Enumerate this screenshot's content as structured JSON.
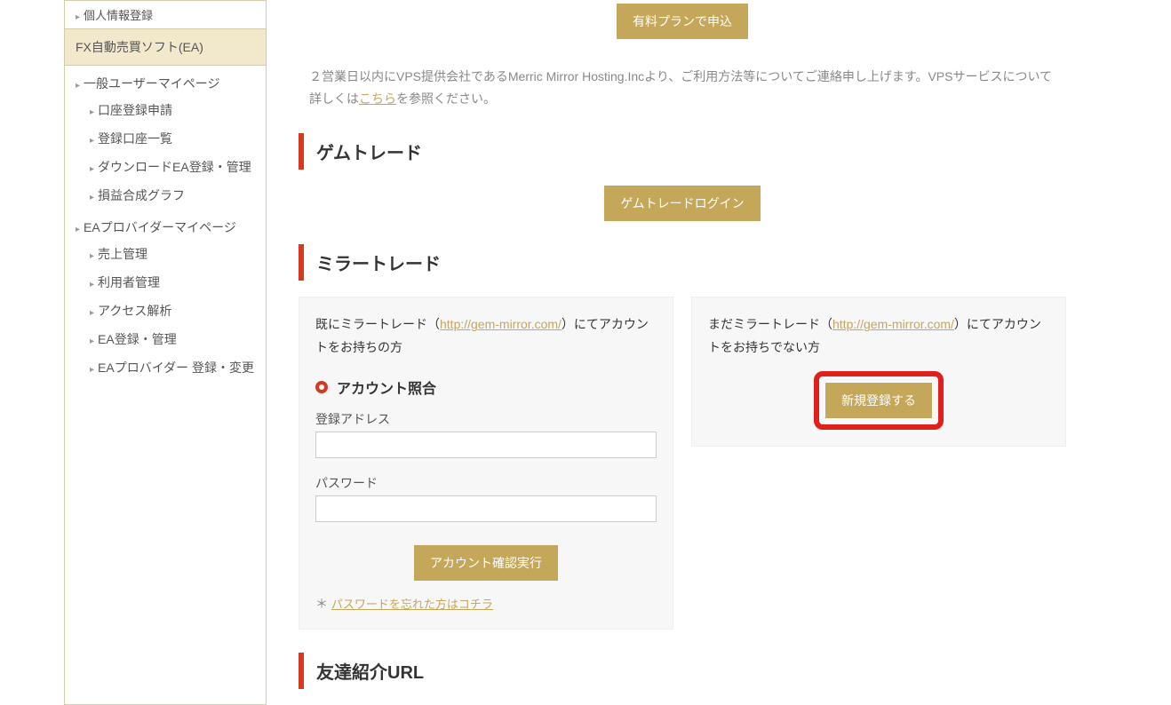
{
  "sidebar": {
    "topItem": "個人情報登録",
    "header": "FX自動売買ソフト(EA)",
    "section1": {
      "title": "一般ユーザーマイページ",
      "items": [
        "口座登録申請",
        "登録口座一覧",
        "ダウンロードEA登録・管理",
        "損益合成グラフ"
      ]
    },
    "section2": {
      "title": "EAプロバイダーマイページ",
      "items": [
        "売上管理",
        "利用者管理",
        "アクセス解析",
        "EA登録・管理",
        "EAプロバイダー 登録・変更"
      ]
    }
  },
  "topButton": "有料プランで申込",
  "vpsInfo": {
    "prefix": "２営業日以内にVPS提供会社であるMerric Mirror Hosting.Incより、ご利用方法等についてご連絡申し上げます。VPSサービスについて詳しくは",
    "link": "こちら",
    "suffix": "を参照ください。"
  },
  "headings": {
    "gemtrade": "ゲムトレード",
    "mirror": "ミラートレード",
    "referral": "友達紹介URL"
  },
  "gemLoginBtn": "ゲムトレードログイン",
  "mirror": {
    "left": {
      "prefix": "既にミラートレード（",
      "link": "http://gem-mirror.com/",
      "suffix": "）にてアカウントをお持ちの方",
      "subheading": "アカウント照合",
      "emailLabel": "登録アドレス",
      "passwordLabel": "パスワード",
      "submitBtn": "アカウント確認実行",
      "forgotPrefix": "＊",
      "forgotLink": "パスワードを忘れた方はコチラ"
    },
    "right": {
      "prefix": "まだミラートレード（",
      "link": "http://gem-mirror.com/",
      "suffix": "）にてアカウントをお持ちでない方",
      "registerBtn": "新規登録する"
    }
  }
}
